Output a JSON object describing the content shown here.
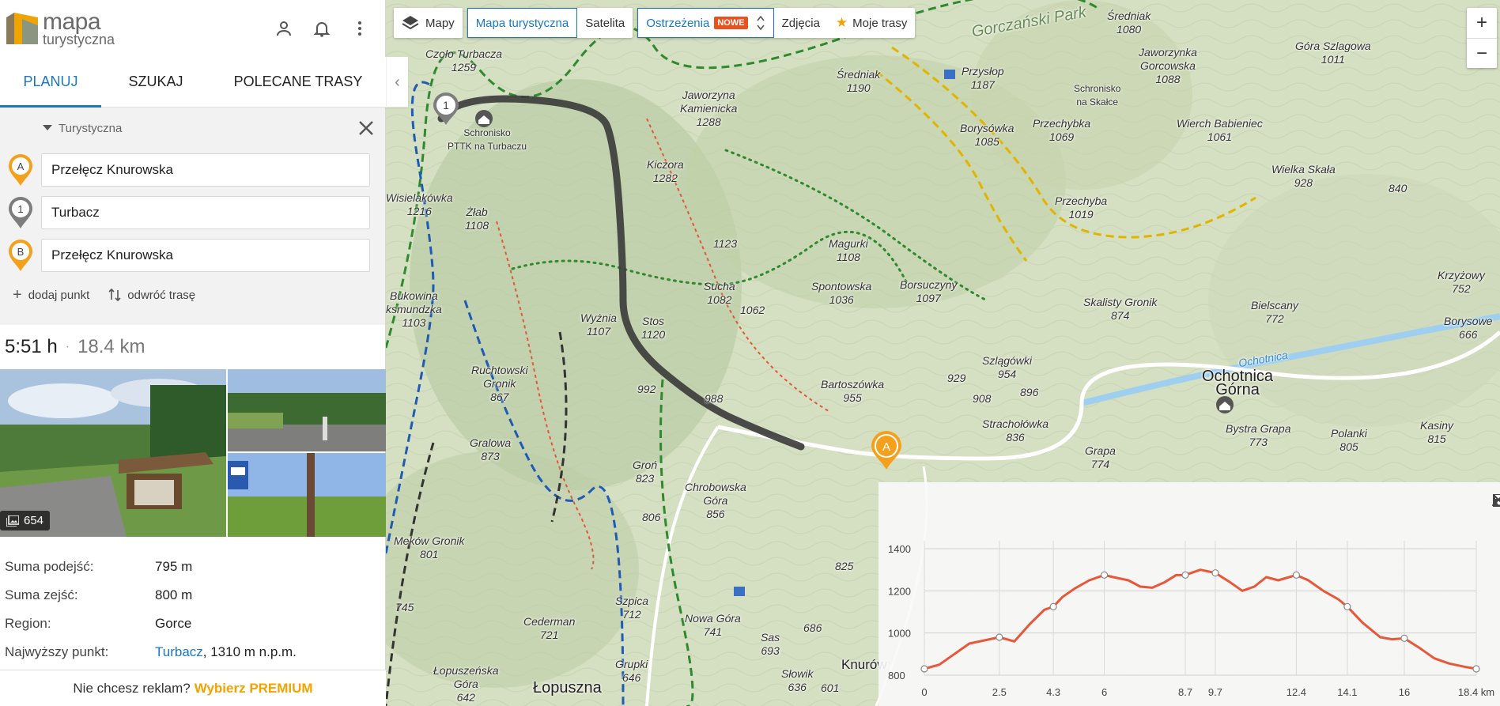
{
  "brand": {
    "name_line1": "mapa",
    "name_line2": "turystyczna"
  },
  "header_icons": [
    "user-icon",
    "bell-icon",
    "more-vert-icon"
  ],
  "tabs": [
    {
      "label": "PLANUJ",
      "active": true
    },
    {
      "label": "SZUKAJ",
      "active": false
    },
    {
      "label": "POLECANE TRASY",
      "active": false
    }
  ],
  "planner": {
    "mode": "Turystyczna",
    "waypoints": [
      {
        "marker": "A",
        "value": "Przełęcz Knurowska"
      },
      {
        "marker": "1",
        "value": "Turbacz"
      },
      {
        "marker": "B",
        "value": "Przełęcz Knurowska"
      }
    ],
    "add_point": "dodaj punkt",
    "reverse_route": "odwróć trasę"
  },
  "summary": {
    "time": "5:51 h",
    "separator": "·",
    "distance": "18.4 km"
  },
  "photos": {
    "count": "654"
  },
  "stats": [
    {
      "label": "Suma podejść:",
      "value": "795 m"
    },
    {
      "label": "Suma zejść:",
      "value": "800 m"
    },
    {
      "label": "Region:",
      "value": "Gorce"
    }
  ],
  "highest_point": {
    "label": "Najwyższy punkt:",
    "link": "Turbacz",
    "suffix": ", 1310 m n.p.m."
  },
  "premium": {
    "text": "Nie chcesz reklam?",
    "link": "Wybierz PREMIUM"
  },
  "map_toolbar": {
    "layers": "Mapy",
    "layer_options": [
      "Mapa turystyczna",
      "Satelita"
    ],
    "warnings": "Ostrzeżenia",
    "warnings_badge": "NOWE",
    "photos": "Zdjęcia",
    "my_routes": "Moje trasy"
  },
  "zoom": {
    "in": "+",
    "out": "−"
  },
  "map_labels": {
    "czolo_turbacza": "Czoło Turbacza",
    "czolo_turbacza_h": "1259",
    "schronisko": "Schronisko",
    "schronisko2": "PTTK na Turbaczu",
    "kiczora": "Kiczora",
    "kiczora_h": "1282",
    "jaworzyna": "Jaworzyna",
    "jaworzyna2": "Kamienicka",
    "jaworzyna_h": "1288",
    "sredniak": "Średniak",
    "sredniak_h": "1190",
    "sredniak2_h": "1080",
    "przyslop": "Przysłop",
    "przyslop_h": "1187",
    "borysowka": "Borysówka",
    "borysowka_h": "1085",
    "przechybka": "Przechybka",
    "przechybka_h": "1069",
    "jaworzynka": "Jaworzynka",
    "jaworzynka2": "Gorcowska",
    "jaworzynka_h": "1088",
    "schr_skalce": "Schronisko",
    "schr_skalce2": "na Skałce",
    "wiercha": "Wierch Babieniec",
    "wiercha_h": "1061",
    "gora_szlagowa": "Góra Szlagowa",
    "gora_szlagowa_h": "1011",
    "wielka_skala": "Wielka Skała",
    "wielka_skala_h": "928",
    "h840": "840",
    "wisielakowka": "Wisielakówka",
    "wisielakowka_h": "1216",
    "zlab": "Żłab",
    "zlab_h": "1108",
    "h1123": "1123",
    "magurki": "Magurki",
    "magurki_h": "1108",
    "przechyba": "Przechyba",
    "przechyba_h": "1019",
    "sucha": "Sucha",
    "sucha_h": "1082",
    "h1062": "1062",
    "spontowska": "Spontowska",
    "spontowska_h": "1036",
    "borsuczyny": "Borsuczyny",
    "borsuczyny_h": "1097",
    "skalisty": "Skalisty Gronik",
    "skalisty_h": "874",
    "bielscany": "Bielscany",
    "bielscany_h": "772",
    "bukowina": "Bukowina",
    "bukowina2": "ksmundzka",
    "bukowina_h": "1103",
    "wyznia": "Wyżnia",
    "wyznia_h": "1107",
    "stos": "Stos",
    "stos_h": "1120",
    "ruchtowski": "Ruchtowski",
    "ruchtowski2": "Gronik",
    "ruchtowski_h": "867",
    "h992": "992",
    "h988": "988",
    "bartoszowka": "Bartoszówka",
    "bartoszowka_h": "955",
    "h929": "929",
    "szlagowki": "Szlągówki",
    "szlagowki_h": "954",
    "h908": "908",
    "h896": "896",
    "ochotnica": "Ochotnica",
    "ochotnica2": "Górna",
    "strachołowka": "Strachołówka",
    "strachołowka_h": "836",
    "bystra_grapa": "Bystra Grapa",
    "bystra_grapa_h": "773",
    "polanki": "Polanki",
    "polanki_h": "805",
    "kasiny": "Kasiny",
    "kasiny_h": "815",
    "grapa": "Grapa",
    "grapa_h": "774",
    "gralowa": "Gralowa",
    "gralowa_h": "873",
    "gron": "Groń",
    "gron_h": "823",
    "chrobowska": "Chrobowska",
    "chrobowska2": "Góra",
    "chrobowska_h": "856",
    "h806": "806",
    "h825": "825",
    "mekow": "Meków Gronik",
    "mekow_h": "801",
    "h745": "745",
    "szpica": "Szpica",
    "szpica_h": "712",
    "nowa_gora": "Nowa Góra",
    "nowa_gora_h": "741",
    "cederman": "Cederman",
    "cederman_h": "721",
    "h686": "686",
    "sas": "Sas",
    "sas_h": "693",
    "lopuszenska": "Łopuszeńska",
    "lopuszenska2": "Góra",
    "lopuszenska_h": "642",
    "grupki": "Grupki",
    "grupki_h": "646",
    "slowik": "Słowik",
    "slowik_h": "636",
    "h601": "601",
    "lopuszna": "Łopuszna",
    "knurow": "Knurów",
    "park": "Gorczański Park",
    "krzyzowy": "Krzyżowy",
    "krzyzowy_h": "752",
    "borysowe": "Borysowe",
    "borysowe_h": "666",
    "ochotnica_river": "Ochotnica"
  },
  "map_markers": {
    "start": "A",
    "via": "1"
  },
  "elevation": {
    "icons": [
      "terrain-icon",
      "save-icon",
      "close-icon"
    ],
    "y_ticks": [
      "1400",
      "1200",
      "1000",
      "800"
    ],
    "x_ticks": [
      "0",
      "2.5",
      "4.3",
      "6",
      "8.7",
      "9.7",
      "12.4",
      "14.1",
      "16",
      "18.4 km"
    ],
    "profile_km": [
      0,
      0.5,
      1,
      1.5,
      2,
      2.5,
      3,
      3.5,
      4,
      4.3,
      4.6,
      5,
      5.5,
      6,
      6.3,
      6.8,
      7.2,
      7.6,
      8,
      8.4,
      8.7,
      9.2,
      9.7,
      10.2,
      10.6,
      11,
      11.4,
      11.8,
      12.4,
      12.8,
      13.3,
      13.8,
      14.1,
      14.6,
      15.2,
      15.6,
      16,
      16.5,
      17,
      17.5,
      18,
      18.4
    ],
    "profile_m": [
      830,
      850,
      900,
      950,
      965,
      980,
      960,
      1040,
      1110,
      1125,
      1170,
      1210,
      1250,
      1275,
      1265,
      1250,
      1220,
      1215,
      1240,
      1275,
      1275,
      1300,
      1285,
      1240,
      1200,
      1220,
      1265,
      1250,
      1275,
      1250,
      1200,
      1160,
      1125,
      1050,
      980,
      970,
      975,
      930,
      880,
      855,
      840,
      830
    ],
    "colors": {
      "line": "#e8573a",
      "grid": "#cfcfcf"
    }
  },
  "colors": {
    "accent": "#1a78c2",
    "route": "#3a3a3a",
    "marker": "#f5a01a",
    "premium": "#f0a400"
  }
}
